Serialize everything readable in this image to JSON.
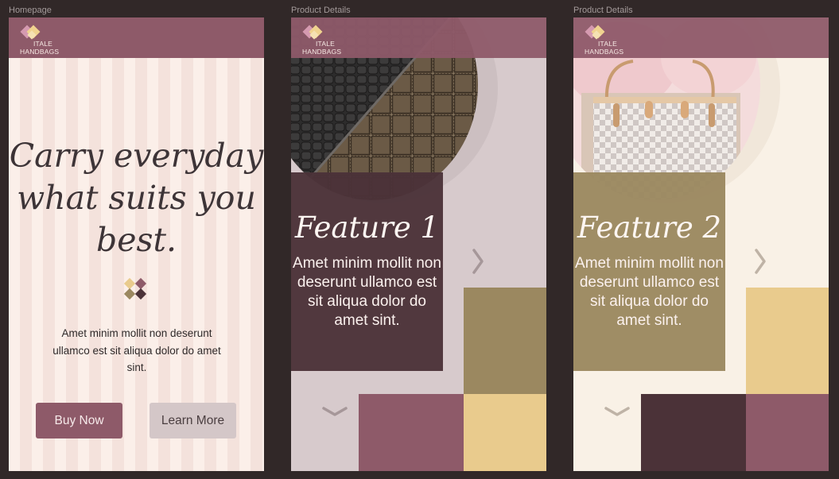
{
  "frames": [
    {
      "label": "Homepage",
      "brand": {
        "line1": "ITALE",
        "line2": "HANDBAGS"
      },
      "headline": {
        "line1": "Carry everyday",
        "line2": "what suits you",
        "line3": "best."
      },
      "body": "Amet minim mollit non deserunt ullamco est sit aliqua dolor do amet sint.",
      "buttons": {
        "buy": "Buy Now",
        "learn": "Learn More"
      }
    },
    {
      "label": "Product Details",
      "brand": {
        "line1": "ITALE",
        "line2": "HANDBAGS"
      },
      "feature_title": "Feature 1",
      "feature_body": "Amet minim mollit non deserunt ullamco est sit aliqua dolor do amet sint."
    },
    {
      "label": "Product Details",
      "brand": {
        "line1": "ITALE",
        "line2": "HANDBAGS"
      },
      "feature_title": "Feature 2",
      "feature_body": "Amet minim mollit non deserunt ullamco est sit aliqua dolor do amet sint."
    }
  ],
  "icons": {
    "logo": "heart-diamond-logo-icon",
    "divider": "four-diamond-icon",
    "next": "chevron-right-icon",
    "down": "chevron-down-icon"
  },
  "colors": {
    "canvas": "#312828",
    "mauve": "#8e5a69",
    "plum": "#4b3238",
    "olive": "#9b8860",
    "gold": "#e9cb8d",
    "cream": "#f9f1e6",
    "blush": "#f7e9e3",
    "lilac_grey": "#d7cacc"
  }
}
